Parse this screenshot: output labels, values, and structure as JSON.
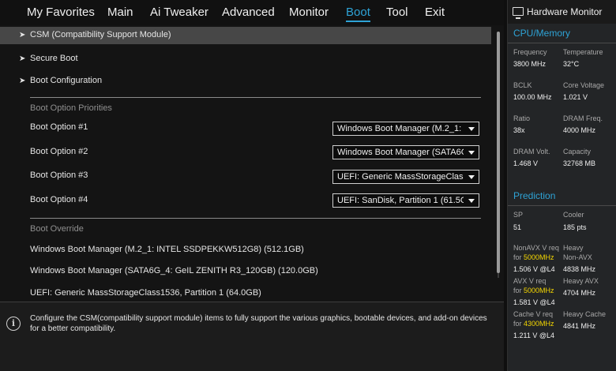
{
  "menu": {
    "items": [
      "My Favorites",
      "Main",
      "Ai Tweaker",
      "Advanced",
      "Monitor",
      "Boot",
      "Tool",
      "Exit"
    ],
    "active": "Boot"
  },
  "submenus": [
    {
      "label": "CSM (Compatibility Support Module)",
      "selected": true
    },
    {
      "label": "Secure Boot",
      "selected": false
    },
    {
      "label": "Boot Configuration",
      "selected": false
    }
  ],
  "boot_priorities": {
    "title": "Boot Option Priorities",
    "options": [
      {
        "label": "Boot Option #1",
        "value": "Windows Boot Manager (M.2_1:"
      },
      {
        "label": "Boot Option #2",
        "value": "Windows Boot Manager (SATA6G"
      },
      {
        "label": "Boot Option #3",
        "value": "UEFI: Generic MassStorageClass"
      },
      {
        "label": "Boot Option #4",
        "value": "UEFI: SanDisk, Partition 1 (61.5G"
      }
    ]
  },
  "boot_override": {
    "title": "Boot Override",
    "items": [
      "Windows Boot Manager (M.2_1: INTEL SSDPEKKW512G8) (512.1GB)",
      "Windows Boot Manager (SATA6G_4: GeIL ZENITH R3_120GB) (120.0GB)",
      "UEFI: Generic MassStorageClass1536, Partition 1 (64.0GB)"
    ]
  },
  "info": {
    "text": "Configure the CSM(compatibility support module) items to fully support the various graphics, bootable devices, and add-on devices for a better compatibility."
  },
  "hardware_monitor": {
    "title": "Hardware Monitor",
    "cpu_memory": {
      "title": "CPU/Memory",
      "rows": [
        [
          {
            "label": "Frequency",
            "value": "3800 MHz"
          },
          {
            "label": "Temperature",
            "value": "32°C"
          }
        ],
        [
          {
            "label": "BCLK",
            "value": "100.00 MHz"
          },
          {
            "label": "Core Voltage",
            "value": "1.021 V"
          }
        ],
        [
          {
            "label": "Ratio",
            "value": "38x"
          },
          {
            "label": "DRAM Freq.",
            "value": "4000 MHz"
          }
        ],
        [
          {
            "label": "DRAM Volt.",
            "value": "1.468 V"
          },
          {
            "label": "Capacity",
            "value": "32768 MB"
          }
        ]
      ]
    },
    "prediction": {
      "title": "Prediction",
      "sp_label": "SP",
      "sp_value": "51",
      "cooler_label": "Cooler",
      "cooler_value": "185 pts",
      "nonavx": {
        "l1": "NonAVX V req",
        "l2a": "for ",
        "freq": "5000MHz",
        "value": "1.506 V @L4",
        "r1": "Heavy",
        "r2": "Non-AVX",
        "rvalue": "4838 MHz"
      },
      "avx": {
        "l1": "AVX V req",
        "l2a": "for ",
        "freq": "5000MHz",
        "value": "1.581 V @L4",
        "r1": "Heavy AVX",
        "rvalue": "4704 MHz"
      },
      "cache": {
        "l1": "Cache V req",
        "l2a": "for ",
        "freq": "4300MHz",
        "value": "1.211 V @L4",
        "r1": "Heavy Cache",
        "rvalue": "4841 MHz"
      }
    }
  },
  "colors": {
    "accent": "#2ea3d6",
    "highlight": "#f5d700"
  }
}
